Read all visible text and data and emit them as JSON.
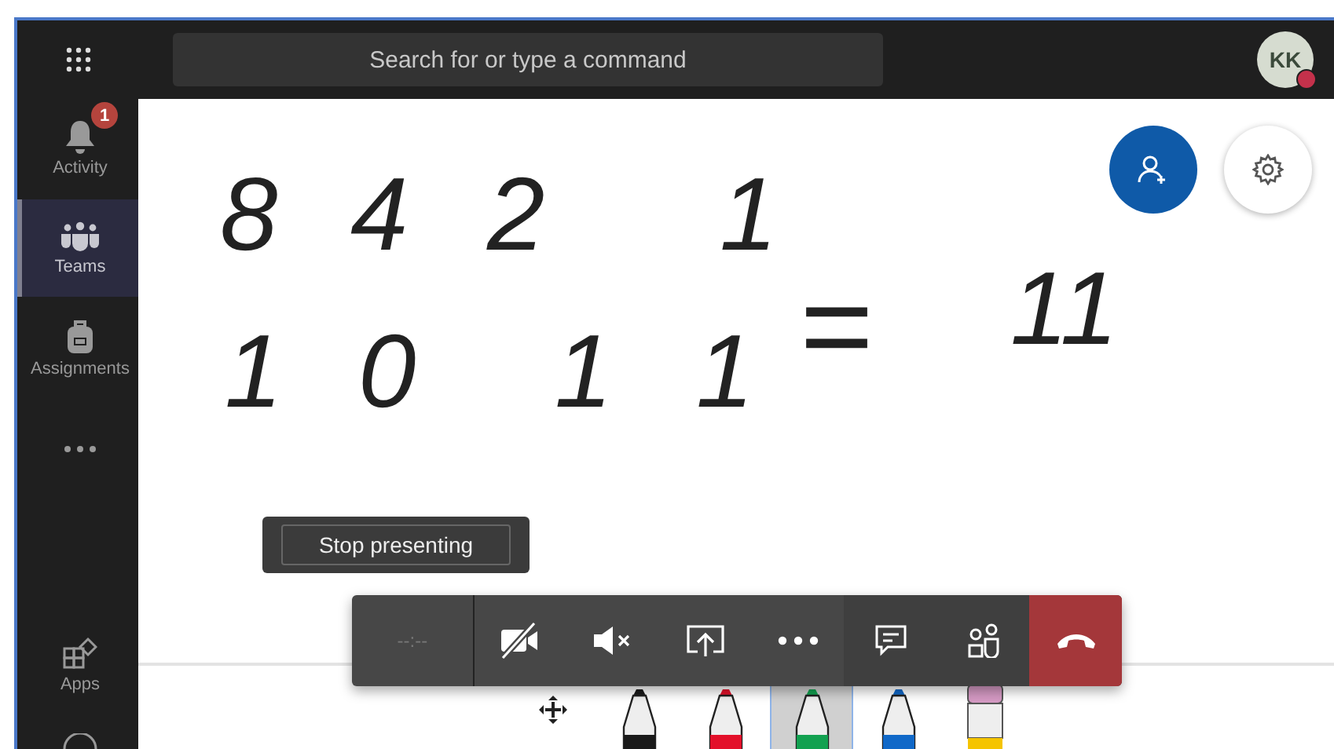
{
  "top_bar": {
    "search": {
      "placeholder": "Search for or type a command"
    },
    "avatar": {
      "initials": "KK",
      "busy": true
    }
  },
  "sidebar": {
    "items": [
      {
        "kind": "activity",
        "label": "Activity",
        "badge": "1",
        "selected": false
      },
      {
        "kind": "teams",
        "label": "Teams",
        "selected": true
      },
      {
        "kind": "assignments",
        "label": "Assignments",
        "selected": false
      },
      {
        "kind": "more",
        "selected": false
      },
      {
        "kind": "apps",
        "label": "Apps",
        "selected": false
      },
      {
        "kind": "help",
        "selected": false
      }
    ]
  },
  "whiteboard": {
    "ink_lines": [
      [
        "8",
        "4",
        "2",
        "1"
      ],
      [
        "1",
        "0",
        "1",
        "1",
        "=",
        "11"
      ]
    ],
    "stop_presenting": "Stop presenting",
    "pens": [
      {
        "kind": "move",
        "selected": false
      },
      {
        "kind": "pen",
        "color": "#1a1a1a",
        "selected": false
      },
      {
        "kind": "pen",
        "color": "#e3102a",
        "selected": false
      },
      {
        "kind": "pen",
        "color": "#12a150",
        "selected": true
      },
      {
        "kind": "pen",
        "color": "#1068c8",
        "selected": false
      },
      {
        "kind": "eraser",
        "color": "#f5c400",
        "selected": false
      }
    ]
  },
  "call_controls": {
    "timer": "--:--",
    "buttons": [
      {
        "kind": "camera-off"
      },
      {
        "kind": "mute"
      },
      {
        "kind": "share"
      },
      {
        "kind": "more"
      },
      {
        "kind": "chat"
      },
      {
        "kind": "participants"
      },
      {
        "kind": "hangup"
      }
    ]
  }
}
